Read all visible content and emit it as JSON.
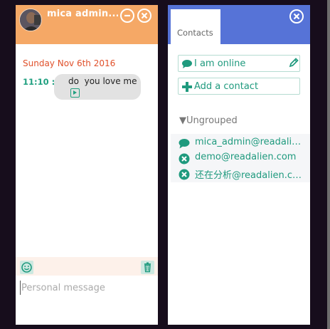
{
  "colors": {
    "chat_header": "#f5a866",
    "contacts_header": "#5673d7",
    "accent_green": "#1f9a7e",
    "date_red": "#e0502a"
  },
  "chat": {
    "title": "mica admin...",
    "minimize_icon": "minus-circle-icon",
    "close_icon": "close-circle-icon",
    "date": "Sunday Nov 6th 2016",
    "messages": [
      {
        "time": "11:10 :",
        "text": "do  you love me"
      }
    ],
    "toolbar": {
      "emoji_icon": "smiley-icon",
      "clear_icon": "trash-icon"
    },
    "input_placeholder": "Personal message"
  },
  "contacts": {
    "tab_label": "Contacts",
    "close_icon": "close-circle-icon",
    "status_button": "I am online",
    "add_contact_button": "Add a contact",
    "group_label": "▼Ungrouped",
    "items": [
      {
        "name": "mica_admin@readalien.com",
        "status_icon": "chat-bubble-icon"
      },
      {
        "name": "demo@readalien.com",
        "status_icon": "offline-x-icon"
      },
      {
        "name": "还在分析@readalien.com",
        "status_icon": "offline-x-icon"
      }
    ]
  }
}
